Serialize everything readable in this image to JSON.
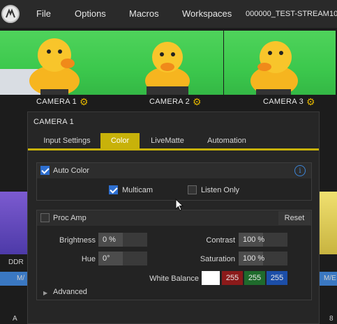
{
  "menubar": {
    "items": [
      "File",
      "Options",
      "Macros",
      "Workspaces"
    ],
    "session_name": "000000_TEST-STREAM",
    "trailing_text": "10"
  },
  "cameras": [
    {
      "label": "CAMERA 1",
      "active": true
    },
    {
      "label": "CAMERA 2",
      "active": false
    },
    {
      "label": "CAMERA 3",
      "active": false
    }
  ],
  "background": {
    "left_label": "DDR",
    "left_tab": "M/",
    "right_tab": "M/E",
    "bottom_left": "A",
    "bottom_right": "8"
  },
  "panel": {
    "title": "CAMERA 1",
    "tabs": [
      "Input Settings",
      "Color",
      "LiveMatte",
      "Automation"
    ],
    "active_tab": "Color",
    "auto_color": {
      "label": "Auto Color",
      "checked": true,
      "info_icon": "info-icon",
      "multicam": {
        "label": "Multicam",
        "checked": true
      },
      "listen_only": {
        "label": "Listen Only",
        "checked": false
      }
    },
    "proc_amp": {
      "label": "Proc Amp",
      "checked": false,
      "reset_label": "Reset",
      "brightness": {
        "label": "Brightness",
        "value": "0 %",
        "level": 0.5
      },
      "contrast": {
        "label": "Contrast",
        "value": "100 %",
        "level": 0.5
      },
      "hue": {
        "label": "Hue",
        "value": "0°",
        "level": 0.5
      },
      "saturation": {
        "label": "Saturation",
        "value": "100 %",
        "level": 0.5
      },
      "white_balance": {
        "label": "White Balance",
        "swatch_color": "#ffffff",
        "r": "255",
        "g": "255",
        "b": "255"
      }
    },
    "advanced": {
      "label": "Advanced"
    }
  },
  "colors": {
    "accent": "#c8b20a",
    "checkbox_blue": "#2e6fd0",
    "gear": "#e0b400",
    "red_channel": "#8b1a1a",
    "green_channel": "#1f6b2c",
    "blue_channel": "#1c4ea8"
  }
}
